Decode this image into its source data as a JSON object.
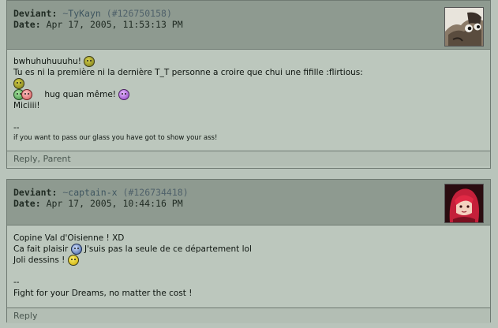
{
  "comments": [
    {
      "label_deviant": "Deviant:",
      "prefix": "~",
      "username": "TyKayn",
      "paren_open": "(",
      "id": "#126750158",
      "paren_close": ")",
      "label_date": "Date:",
      "date": "Apr 17, 2005, 11:53:13 PM",
      "avatar_icon": "cat-avatar",
      "lines": {
        "l1": "bwhuhuhuuuhu!",
        "l2": "Tu es ni la première ni la dernière T_T personne a croire que chui une fifille :flirtious:",
        "l3": "hug quan même!",
        "l4": "Miciiii!",
        "sig_dash": "--",
        "sig": "if you want to pass our glass you have got to show your ass!"
      },
      "footer": {
        "reply": "Reply",
        "sep": ",",
        "parent": "Parent"
      }
    },
    {
      "label_deviant": "Deviant:",
      "prefix": "~",
      "username": "captain-x",
      "paren_open": "(",
      "id": "#126734418",
      "paren_close": ")",
      "label_date": "Date:",
      "date": "Apr 17, 2005, 10:44:16 PM",
      "avatar_icon": "anime-girl-avatar",
      "lines": {
        "l1": "Copine Val d'Oisienne ! XD",
        "l2a": "Ca fait plaisir",
        "l2b": "J'suis pas la seule de ce département lol",
        "l3": "Joli dessins !",
        "sig_dash": "--",
        "sig": "Fight for your Dreams, no matter the cost !"
      },
      "footer": {
        "reply": "Reply"
      }
    }
  ]
}
